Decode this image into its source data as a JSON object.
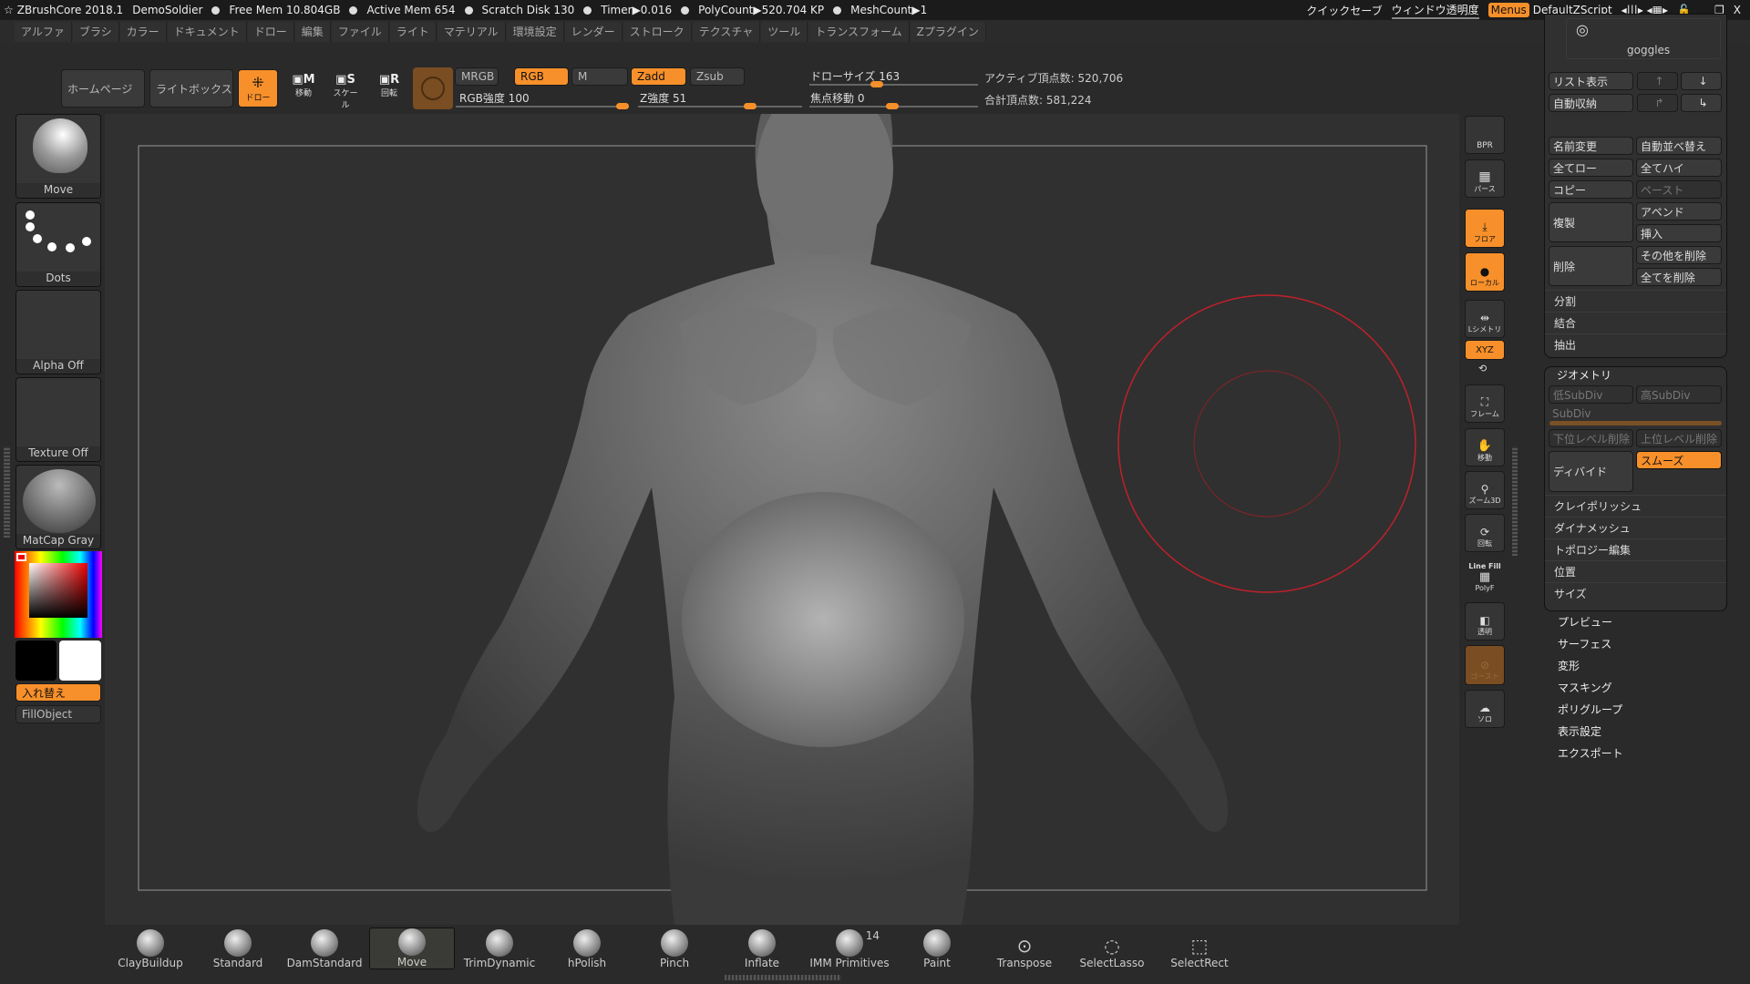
{
  "titlebar": {
    "app": "ZBrushCore 2018.1",
    "project": "DemoSoldier",
    "free_mem": "Free Mem 10.804GB",
    "active_mem": "Active Mem 654",
    "scratch": "Scratch Disk 130",
    "timer": "Timer▶0.016",
    "polycount": "PolyCount▶520.704 KP",
    "meshcount": "MeshCount▶1",
    "quicksave": "クイックセーブ",
    "transparency": "ウィンドウ透明度",
    "menus": "Menus",
    "script": "DefaultZScript"
  },
  "menubar": [
    "アルファ",
    "ブラシ",
    "カラー",
    "ドキュメント",
    "ドロー",
    "編集",
    "ファイル",
    "ライト",
    "マテリアル",
    "環境設定",
    "レンダー",
    "ストローク",
    "テクスチャ",
    "ツール",
    "トランスフォーム",
    "Zプラグイン"
  ],
  "toolbar": {
    "home": "ホームページ",
    "lightbox": "ライトボックス",
    "draw": "ドロー",
    "move": "移動",
    "scale": "スケール",
    "rotate": "回転",
    "mrgb": "MRGB",
    "rgb": "RGB",
    "m": "M",
    "zadd": "Zadd",
    "zsub": "Zsub",
    "rgb_intensity": "RGB強度 100",
    "z_intensity": "Z強度 51",
    "draw_size": "ドローサイズ 163",
    "focal_shift": "焦点移動 0",
    "active_points": "アクティブ頂点数: 520,706",
    "total_points": "合計頂点数: 581,224",
    "rgb_intensity_value": 100,
    "z_intensity_value": 51,
    "draw_size_value": 163,
    "focal_shift_value": 0
  },
  "left": {
    "brush": "Move",
    "stroke": "Dots",
    "alpha": "Alpha Off",
    "texture": "Texture Off",
    "material": "MatCap Gray",
    "swap": "入れ替え",
    "fill": "FillObject"
  },
  "right_tools": [
    "BPR",
    "パース",
    "フロア",
    "ローカル",
    "Lシメトリ",
    "XYZ",
    "フレーム",
    "移動",
    "ズーム3D",
    "回転",
    "PolyF",
    "透明",
    "ゴースト",
    "ソロ"
  ],
  "right_tools_extra": {
    "linefill": "Line Fill"
  },
  "subtool": {
    "name": "goggles",
    "list": "リスト表示",
    "autocollapse": "自動収納",
    "rename": "名前変更",
    "autoreorder": "自動並べ替え",
    "alllow": "全てロー",
    "allhigh": "全てハイ",
    "copy": "コピー",
    "paste": "ペースト",
    "duplicate": "複製",
    "append": "アペンド",
    "insert": "挿入",
    "delete": "削除",
    "delother": "その他を削除",
    "delall": "全てを削除",
    "split": "分割",
    "merge": "結合",
    "extract": "抽出"
  },
  "geometry": {
    "title": "ジオメトリ",
    "lower": "低SubDiv",
    "higher": "高SubDiv",
    "subdiv": "SubDiv",
    "dellower": "下位レベル削除",
    "delhigher": "上位レベル削除",
    "divide": "ディバイド",
    "smooth": "スムーズ",
    "rows": [
      "クレイポリッシュ",
      "ダイナメッシュ",
      "トポロジー編集",
      "位置",
      "サイズ"
    ]
  },
  "subpanels": [
    "プレビュー",
    "サーフェス",
    "変形",
    "マスキング",
    "ポリグループ",
    "表示設定",
    "エクスポート"
  ],
  "brushes": [
    "ClayBuildup",
    "Standard",
    "DamStandard",
    "Move",
    "TrimDynamic",
    "hPolish",
    "Pinch",
    "Inflate",
    "IMM Primitives",
    "Paint",
    "Transpose",
    "SelectLasso",
    "SelectRect"
  ],
  "imm_count": "14",
  "colors": {
    "accent": "#f7902a",
    "cursor": "#c0202a",
    "bg": "#2a2a2a"
  }
}
